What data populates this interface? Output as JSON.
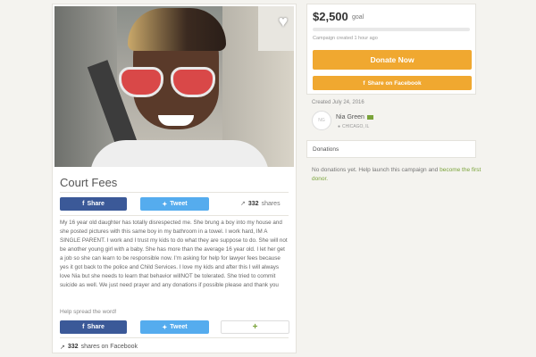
{
  "campaign": {
    "title": "Court Fees",
    "story": "My 16 year old daughter has totally disrespected me. She brung a boy into my house and she posted pictures with this same boy in my bathroom in a towel. I work hard, IM A SINGLE PARENT. I work and I trust my kids to do what they are suppose to do. She will not be another young girl with a baby. She has more than the average 16 year old. I let her get a job so she can learn to be responsible now. I'm asking for help for lawyer fees because yes it got back to the police and Child Services. I love my kids and after this I will always love Nia but she needs to learn that behavior willNOT be tolerated. She tried to commit suicide as well. We just need prayer and any donations if possible please and thank you",
    "spread": "Help spread the word!",
    "shares_count": "332",
    "shares_label": "shares",
    "fb_shares_count": "332",
    "fb_shares_label": "shares on Facebook"
  },
  "share_buttons": {
    "facebook": "Share",
    "twitter": "Tweet",
    "plus": "+"
  },
  "goal": {
    "amount": "$2,500",
    "label": "goal",
    "progress_fraction": 0.0,
    "created": "Campaign created 1 hour ago",
    "donate_label": "Donate Now",
    "share_fb_label": "Share on Facebook"
  },
  "owner": {
    "created": "Created July 24, 2016",
    "avatar_text": "NG",
    "name": "Nia Green",
    "location": "CHICAGO, IL"
  },
  "donations": {
    "title": "Donations",
    "text": "No donations yet. Help launch this campaign and ",
    "link": "become the first donor."
  },
  "colors": {
    "facebook": "#3b5998",
    "twitter": "#55acee",
    "donate": "#f0a830",
    "accent": "#7aa33a"
  }
}
